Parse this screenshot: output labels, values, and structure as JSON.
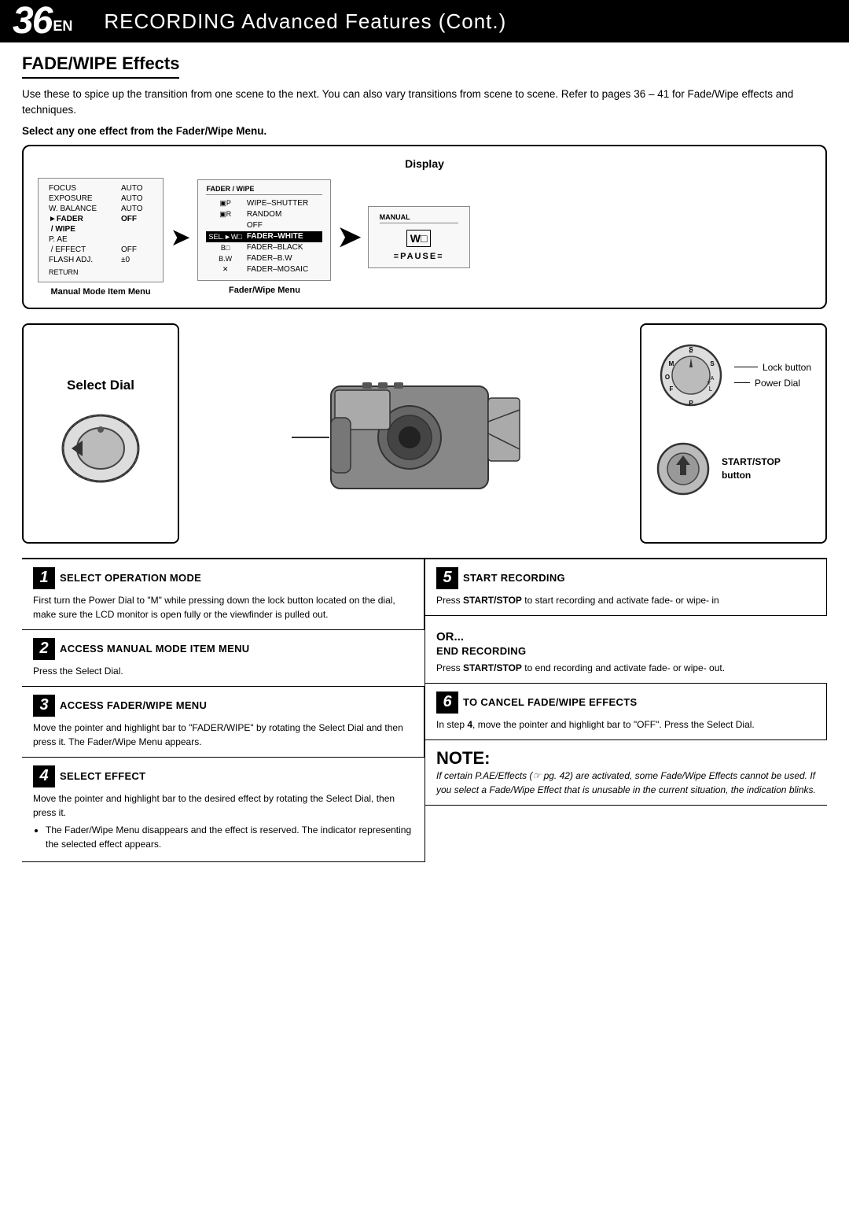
{
  "header": {
    "page_num": "36",
    "page_en": "EN",
    "title_recording": "RECORDING",
    "title_rest": " Advanced Features (Cont.)"
  },
  "section": {
    "title": "FADE/WIPE Effects",
    "intro": "Use these to spice up the transition from one scene to the next. You can also vary transitions from scene to scene. Refer to pages 36 – 41 for Fade/Wipe effects and techniques.",
    "sub_heading": "Select any one effect from the Fader/Wipe Menu."
  },
  "display": {
    "label": "Display",
    "manual_mode_caption": "Manual Mode Item  Menu",
    "fader_wipe_caption": "Fader/Wipe Menu",
    "menu1": {
      "label": "",
      "rows": [
        {
          "col1": "FOCUS",
          "col2": "AUTO",
          "highlight": false,
          "arrow": false
        },
        {
          "col1": "EXPOSURE",
          "col2": "AUTO",
          "highlight": false,
          "arrow": false
        },
        {
          "col1": "W. BALANCE",
          "col2": "AUTO",
          "highlight": false,
          "arrow": false
        },
        {
          "col1": "►FADER",
          "col2": "OFF",
          "highlight": false,
          "arrow": false,
          "bold": true
        },
        {
          "col1": "/ WIPE",
          "col2": "",
          "highlight": false,
          "arrow": false,
          "bold": true
        },
        {
          "col1": "P. AE",
          "col2": "",
          "highlight": false,
          "arrow": false
        },
        {
          "col1": "/ EFFECT",
          "col2": "OFF",
          "highlight": false,
          "arrow": false
        },
        {
          "col1": "FLASH ADJ.",
          "col2": "±0",
          "highlight": false,
          "arrow": false
        }
      ],
      "return": "RETURN"
    },
    "menu2": {
      "label": "FADER / WIPE",
      "rows": [
        {
          "icon": "▣P",
          "text": "WIPE–SHUTTER",
          "highlight": false
        },
        {
          "icon": "▣R",
          "text": "RANDOM",
          "highlight": false
        },
        {
          "icon": "",
          "text": "OFF",
          "highlight": false
        },
        {
          "icon": "SEL.►W□",
          "text": "FADER–WHITE",
          "highlight": true
        },
        {
          "icon": "B□",
          "text": "FADER–BLACK",
          "highlight": false
        },
        {
          "icon": "B.W",
          "text": "FADER–B.W",
          "highlight": false
        },
        {
          "icon": "✕",
          "text": "FADER–MOSAIC",
          "highlight": false
        }
      ]
    },
    "menu3": {
      "label": "MANUAL",
      "sub_label": "W□",
      "pause_text": "≡PAUSE≡"
    }
  },
  "diagram": {
    "select_dial_label": "Select Dial",
    "lock_button_label": "Lock button",
    "power_dial_label": "Power Dial",
    "start_stop_label": "START/STOP\nbutton"
  },
  "steps": [
    {
      "num": "1",
      "title": "SELECT OPERATION MODE",
      "body": "First turn the Power Dial to \"M\" while pressing down the lock button located on the dial, make sure the LCD monitor is open fully or the viewfinder is pulled out."
    },
    {
      "num": "2",
      "title": "ACCESS MANUAL MODE ITEM MENU",
      "body": "Press the Select Dial."
    },
    {
      "num": "3",
      "title": "ACCESS FADER/WIPE MENU",
      "body": "Move the pointer and highlight bar to \"FADER/WIPE\" by rotating the Select Dial and then press it. The Fader/Wipe Menu appears."
    },
    {
      "num": "4",
      "title": "SELECT EFFECT",
      "body": "Move the pointer and highlight bar to the desired effect by rotating the Select Dial, then press it.",
      "bullet": "The Fader/Wipe Menu disappears and the effect is reserved. The indicator representing the selected effect appears."
    },
    {
      "num": "5",
      "title": "START RECORDING",
      "body": "Press START/STOP to start recording and activate fade- or wipe- in",
      "or_label": "OR...",
      "end_title": "END RECORDING",
      "end_body": "Press START/STOP to end recording and activate fade- or wipe- out."
    },
    {
      "num": "6",
      "title": "TO CANCEL FADE/WIPE EFFECTS",
      "body": "In step 4, move the pointer and highlight bar to \"OFF\". Press the Select Dial."
    }
  ],
  "note": {
    "title": "NOTE:",
    "body": "If certain P.AE/Effects (☞ pg. 42) are activated, some Fade/Wipe Effects cannot be used. If you select a Fade/Wipe Effect that is unusable in the current situation, the indication blinks."
  }
}
